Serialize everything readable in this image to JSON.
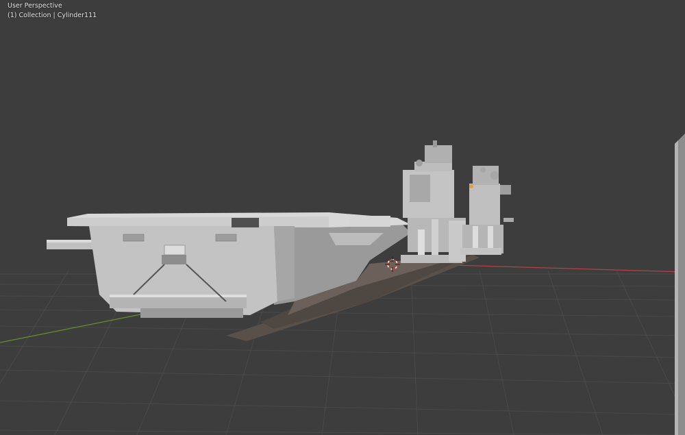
{
  "viewport": {
    "view_name": "User Perspective",
    "collection_label": "(1) Collection | Cylinder111"
  },
  "colors": {
    "background": "#3d3d3d",
    "grid": "#4a4a4a",
    "x_axis": "#b0444a",
    "y_axis": "#6c8e2b",
    "model": "#c9c9c9",
    "model_shadow": "#595049"
  },
  "icons": {
    "cursor": "3d-cursor-icon"
  }
}
